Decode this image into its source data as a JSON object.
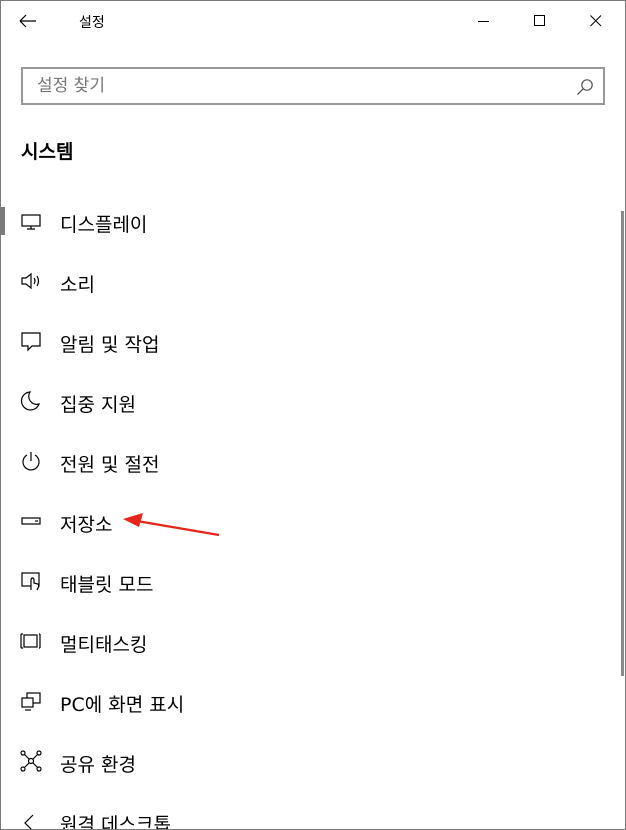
{
  "window": {
    "title": "설정"
  },
  "search": {
    "placeholder": "설정 찾기"
  },
  "section": {
    "title": "시스템"
  },
  "nav_items": [
    {
      "label": "디스플레이",
      "icon": "monitor-icon",
      "selected": true
    },
    {
      "label": "소리",
      "icon": "speaker-icon"
    },
    {
      "label": "알림 및 작업",
      "icon": "notification-icon"
    },
    {
      "label": "집중 지원",
      "icon": "moon-icon"
    },
    {
      "label": "전원 및 절전",
      "icon": "power-icon"
    },
    {
      "label": "저장소",
      "icon": "storage-icon"
    },
    {
      "label": "태블릿 모드",
      "icon": "tablet-icon"
    },
    {
      "label": "멀티태스킹",
      "icon": "multitasking-icon"
    },
    {
      "label": "PC에 화면 표시",
      "icon": "project-icon"
    },
    {
      "label": "공유 환경",
      "icon": "share-icon"
    },
    {
      "label": "원격 데스크톱",
      "icon": "remote-desktop-icon"
    }
  ],
  "colors": {
    "annotation_arrow": "#e8251c",
    "selection_bar": "#7a7a7a"
  }
}
